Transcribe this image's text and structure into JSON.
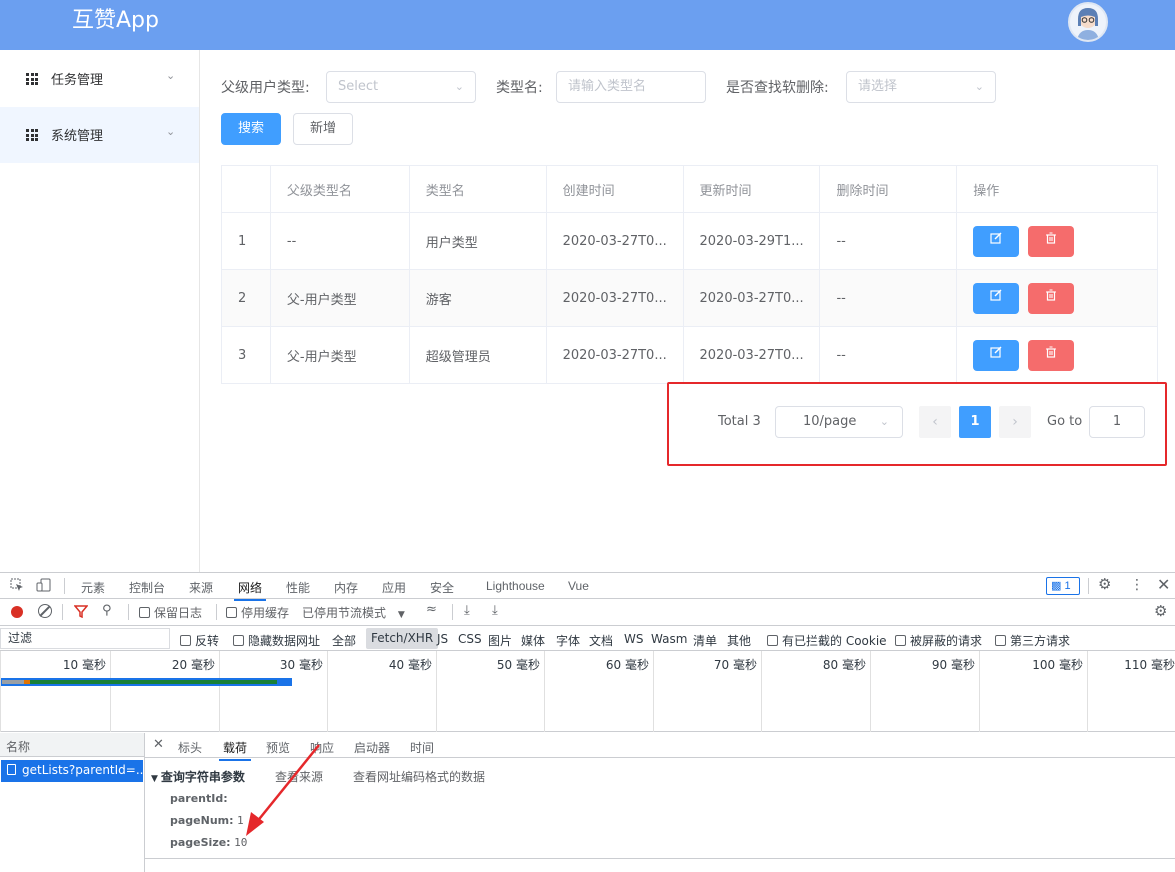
{
  "header": {
    "app_title": "互赞App"
  },
  "sidebar": {
    "items": [
      {
        "label": "任务管理"
      },
      {
        "label": "系统管理"
      }
    ]
  },
  "filters": {
    "parent_type_label": "父级用户类型:",
    "parent_type_placeholder": "Select",
    "type_name_label": "类型名:",
    "type_name_placeholder": "请输入类型名",
    "soft_delete_label": "是否查找软删除:",
    "soft_delete_placeholder": "请选择"
  },
  "actions": {
    "search": "搜索",
    "add": "新增"
  },
  "table": {
    "headers": [
      "",
      "父级类型名",
      "类型名",
      "创建时间",
      "更新时间",
      "删除时间",
      "操作"
    ],
    "rows": [
      {
        "index": "1",
        "parent": "--",
        "name": "用户类型",
        "created": "2020-03-27T0...",
        "updated": "2020-03-29T1...",
        "deleted": "--"
      },
      {
        "index": "2",
        "parent": "父-用户类型",
        "name": "游客",
        "created": "2020-03-27T0...",
        "updated": "2020-03-27T0...",
        "deleted": "--"
      },
      {
        "index": "3",
        "parent": "父-用户类型",
        "name": "超级管理员",
        "created": "2020-03-27T0...",
        "updated": "2020-03-27T0...",
        "deleted": "--"
      }
    ]
  },
  "pagination": {
    "total": "Total 3",
    "page_size": "10/page",
    "current_page": "1",
    "goto_label": "Go to",
    "goto_value": "1"
  },
  "devtools": {
    "tabs": [
      "元素",
      "控制台",
      "来源",
      "网络",
      "性能",
      "内存",
      "应用",
      "安全",
      "Lighthouse",
      "Vue"
    ],
    "active_tab": "网络",
    "message_count": "1",
    "toolbar": {
      "preserve_log": "保留日志",
      "disable_cache": "停用缓存",
      "throttle": "已停用节流模式"
    },
    "filter": {
      "placeholder": "过滤",
      "invert": "反转",
      "hide_data_urls": "隐藏数据网址",
      "types": [
        "全部",
        "Fetch/XHR",
        "JS",
        "CSS",
        "图片",
        "媒体",
        "字体",
        "文档",
        "WS",
        "Wasm",
        "清单",
        "其他"
      ],
      "blocked_cookies": "有已拦截的 Cookie",
      "blocked_requests": "被屏蔽的请求",
      "third_party": "第三方请求"
    },
    "timeline_ticks": [
      "10 毫秒",
      "20 毫秒",
      "30 毫秒",
      "40 毫秒",
      "50 毫秒",
      "60 毫秒",
      "70 毫秒",
      "80 毫秒",
      "90 毫秒",
      "100 毫秒",
      "110 毫秒"
    ],
    "name_header": "名称",
    "request_name": "getLists?parentId=...",
    "detail_tabs": [
      "标头",
      "载荷",
      "预览",
      "响应",
      "启动器",
      "时间"
    ],
    "active_detail_tab": "载荷",
    "payload": {
      "section_title": "查询字符串参数",
      "view_source": "查看来源",
      "view_url_encoded": "查看网址编码格式的数据",
      "params": [
        {
          "key": "parentId:",
          "value": ""
        },
        {
          "key": "pageNum:",
          "value": "1"
        },
        {
          "key": "pageSize:",
          "value": "10"
        }
      ]
    }
  },
  "colors": {
    "header_bg": "#6b9ff0",
    "primary": "#409eff",
    "danger": "#f56c6c",
    "highlight_box": "#e5282b"
  }
}
